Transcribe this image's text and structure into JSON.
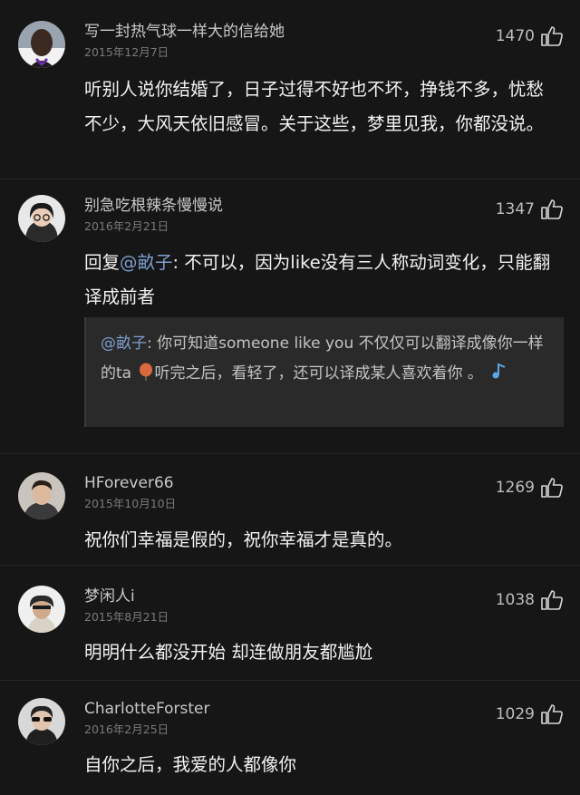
{
  "comments": [
    {
      "username": "写一封热气球一样大的信给她",
      "date": "2015年12月7日",
      "likes": "1470",
      "body": "听别人说你结婚了，日子过得不好也不坏，挣钱不多，忧愁不少，大风天依旧感冒。关于这些，梦里见我，你都没说。"
    },
    {
      "username": "别急吃根辣条慢慢说",
      "date": "2016年2月21日",
      "likes": "1347",
      "reply_prefix": "回复",
      "reply_mention": "@畝子",
      "body": ": 不可以，因为like没有三人称动词变化，只能翻译成前者",
      "quote": {
        "mention": "@畝子",
        "text": ": 你可知道someone like you 不仅仅可以翻译成像你一样的ta",
        "text2": "听完之后，看轻了，还可以译成某人喜欢着你 。"
      }
    },
    {
      "username": "HForever66",
      "date": "2015年10月10日",
      "likes": "1269",
      "body": "祝你们幸福是假的，祝你幸福才是真的。"
    },
    {
      "username": "梦闲人i",
      "date": "2015年8月21日",
      "likes": "1038",
      "body": "明明什么都没开始 却连做朋友都尴尬"
    },
    {
      "username": "CharlotteForster",
      "date": "2016年2月25日",
      "likes": "1029",
      "body": "自你之后，我爱的人都像你"
    }
  ],
  "icons": {
    "like": "thumbs-up-icon",
    "balloon": "balloon-icon",
    "music": "music-note-icon"
  },
  "colors": {
    "background": "#161616",
    "mention": "#7d9fcf",
    "quote_background": "#2a2a2a",
    "balloon": "#d9693f",
    "music": "#5aa8e6"
  }
}
